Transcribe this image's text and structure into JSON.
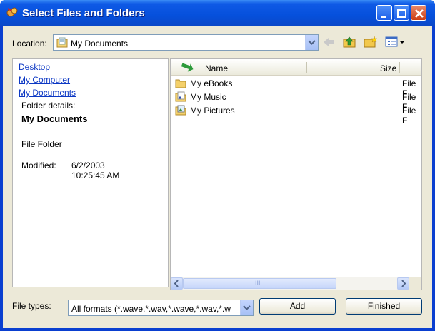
{
  "window": {
    "title": "Select Files and Folders"
  },
  "location": {
    "label": "Location:",
    "value": "My Documents"
  },
  "toolbar": {
    "icons": [
      "back-arrow-icon",
      "up-folder-icon",
      "new-folder-icon",
      "views-icon"
    ]
  },
  "left_pane": {
    "links": [
      "Desktop",
      "My Computer",
      "My Documents"
    ],
    "details_heading": "Folder details:",
    "folder_name": "My Documents",
    "folder_type": "File Folder",
    "modified_label": "Modified:",
    "modified_date": "6/2/2003",
    "modified_time": "10:25:45 AM"
  },
  "file_list": {
    "columns": {
      "name": "Name",
      "size": "Size"
    },
    "rows": [
      {
        "name": "My eBooks",
        "type": "File F",
        "icon": "folder-icon"
      },
      {
        "name": "My Music",
        "type": "File F",
        "icon": "music-folder-icon"
      },
      {
        "name": "My Pictures",
        "type": "File F",
        "icon": "pictures-folder-icon"
      }
    ],
    "scroll_grip": "III"
  },
  "footer": {
    "file_types_label": "File types:",
    "file_types_value": "All formats  (*.wave,*.wav,*.wave,*.wav,*.w",
    "add_label": "Add",
    "finished_label": "Finished"
  },
  "colors": {
    "titlebar": "#0650dc",
    "link": "#0b37c4",
    "face": "#ece9d8"
  }
}
